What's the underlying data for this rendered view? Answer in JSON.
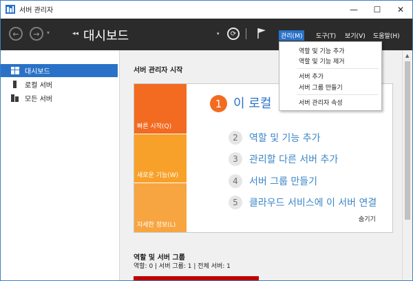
{
  "window": {
    "title": "서버 관리자",
    "minimize": "—",
    "maximize": "☐",
    "close": "✕"
  },
  "navbar": {
    "back": "←",
    "forward": "→",
    "history_dropdown": "▾",
    "breadcrumb_arrows": "◂◂",
    "page_title": "대시보드",
    "title_caret": "▾",
    "refresh": "⟳",
    "menus": [
      {
        "label": "관리(M)",
        "active": true
      },
      {
        "label": "도구(T)",
        "active": false
      },
      {
        "label": "보기(V)",
        "active": false
      },
      {
        "label": "도움말(H)",
        "active": false
      }
    ]
  },
  "sidebar": {
    "items": [
      {
        "label": "대시보드",
        "icon": "dashboard-grid-icon",
        "selected": true
      },
      {
        "label": "로컬 서버",
        "icon": "server-icon",
        "selected": false
      },
      {
        "label": "모든 서버",
        "icon": "servers-icon",
        "selected": false
      }
    ]
  },
  "main": {
    "welcome_title": "서버 관리자 시작",
    "tiles": [
      {
        "label": "빠른 시작(Q)",
        "color": "#f26b21"
      },
      {
        "label": "새로운 기능(W)",
        "color": "#f8a12a"
      },
      {
        "label": "자세한 정보(L)",
        "color": "#f7a540"
      }
    ],
    "step1": {
      "num": "1",
      "label": "이 로컬"
    },
    "steps": [
      {
        "num": "2",
        "label": "역할 및 기능 추가"
      },
      {
        "num": "3",
        "label": "관리할 다른 서버 추가"
      },
      {
        "num": "4",
        "label": "서버 그룹 만들기"
      },
      {
        "num": "5",
        "label": "클라우드 서비스에 이 서버 연결"
      }
    ],
    "hide_label": "숨기기",
    "roles": {
      "title": "역할 및 서버 그룹",
      "stats": "역할: 0   |   서버 그룹: 1   |   전체 서버: 1"
    }
  },
  "dropdown": {
    "groups": [
      [
        "역할 및 기능 추가",
        "역할 및 기능 제거"
      ],
      [
        "서버 추가",
        "서버 그룹 만들기"
      ],
      [
        "서버 관리자 속성"
      ]
    ]
  },
  "colors": {
    "accent": "#2a72c8",
    "navbar": "#2b2b2b",
    "orange": "#f26b21",
    "alert_red": "#c00000"
  }
}
